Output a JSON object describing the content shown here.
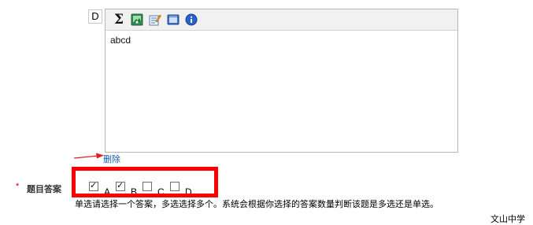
{
  "option": {
    "letter": "D",
    "content": "abcd",
    "delete_label": "删除"
  },
  "toolbar": {
    "items": [
      {
        "icon": "sigma-formula-icon"
      },
      {
        "icon": "insert-image-icon"
      },
      {
        "icon": "edit-note-icon"
      },
      {
        "icon": "media-window-icon"
      },
      {
        "icon": "info-icon"
      }
    ]
  },
  "answer": {
    "required_mark": "*",
    "label": "题目答案",
    "choices": [
      {
        "label": "A",
        "checked": true
      },
      {
        "label": "B",
        "checked": true
      },
      {
        "label": "C",
        "checked": false
      },
      {
        "label": "D",
        "checked": false
      }
    ],
    "hint": "单选请选择一个答案，多选选择多个。系统会根据你选择的答案数量判断该题是多选还是单选。"
  },
  "footer": {
    "school": "文山中学"
  },
  "colors": {
    "highlight": "#ff0000",
    "link": "#1a5aa6",
    "required": "#cc0000"
  }
}
